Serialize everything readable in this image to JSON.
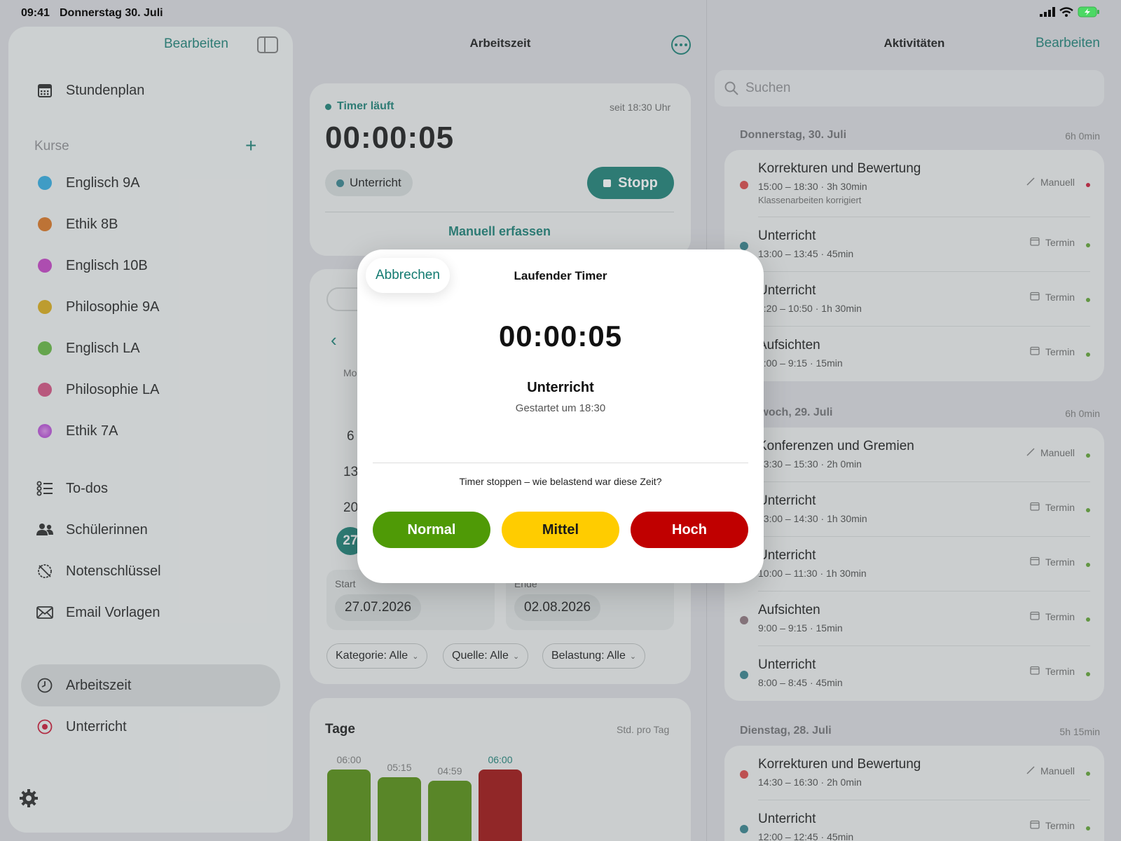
{
  "status": {
    "time": "09:41",
    "date": "Donnerstag 30. Juli"
  },
  "sidebar": {
    "edit_label": "Bearbeiten",
    "stundenplan": "Stundenplan",
    "courses_label": "Kurse",
    "add_symbol": "+",
    "courses": [
      {
        "label": "Englisch 9A",
        "color": "#2aa8e0"
      },
      {
        "label": "Ethik 8B",
        "color": "#d86f1a"
      },
      {
        "label": "Englisch 10B",
        "color": "#c23bc2"
      },
      {
        "label": "Philosophie 9A",
        "color": "#d9a810"
      },
      {
        "label": "Englisch LA",
        "color": "#5fb43a"
      },
      {
        "label": "Philosophie LA",
        "color": "#d24a7c"
      },
      {
        "label": "Ethik 7A",
        "color": "#b84bd6"
      }
    ],
    "nav": [
      {
        "label": "To-dos",
        "icon": "checklist-icon"
      },
      {
        "label": "Schülerinnen",
        "icon": "people-icon"
      },
      {
        "label": "Notenschlüssel",
        "icon": "grade-key-icon"
      },
      {
        "label": "Email Vorlagen",
        "icon": "envelope-icon"
      },
      {
        "label": "Arbeitszeit",
        "icon": "clock-icon",
        "active": true
      },
      {
        "label": "Unterricht",
        "icon": "target-icon"
      }
    ]
  },
  "main": {
    "title": "Arbeitszeit",
    "timer_status": "Timer läuft",
    "timer_since": "seit 18:30 Uhr",
    "timer_value": "00:00:05",
    "category": "Unterricht",
    "stop_label": "Stopp",
    "manual_label": "Manuell erfassen",
    "calendar": {
      "weekday": "Mo",
      "days": [
        "6",
        "13",
        "20",
        "27"
      ]
    },
    "start_label": "Start",
    "start_value": "27.07.2026",
    "end_label": "Ende",
    "end_value": "02.08.2026",
    "filters": [
      "Kategorie: Alle",
      "Quelle: Alle",
      "Belastung: Alle"
    ],
    "days_title": "Tage",
    "days_subtitle": "Std. pro Tag",
    "chart_data": {
      "type": "bar",
      "title": "Tage",
      "ylabel": "Std. pro Tag",
      "data_labels": [
        "06:00",
        "05:15",
        "04:59",
        "06:00"
      ],
      "values": [
        6.0,
        5.25,
        4.98,
        6.0
      ],
      "colors": [
        "#4e8a06",
        "#4e8a06",
        "#4e8a06",
        "#9b0606"
      ],
      "ylim": [
        0,
        6
      ]
    }
  },
  "activities": {
    "title": "Aktivitäten",
    "edit_label": "Bearbeiten",
    "search_placeholder": "Suchen",
    "days": [
      {
        "header": "Donnerstag, 30. Juli",
        "total": "6h 0min",
        "items": [
          {
            "title": "Korrekturen und Bewertung",
            "time": "15:00 – 18:30 · 3h 30min",
            "note": "Klassenarbeiten korrigiert",
            "source": "Manuell",
            "dot": "#d84040",
            "status": "#c8102e"
          },
          {
            "title": "Unterricht",
            "time": "13:00 – 13:45 · 45min",
            "source": "Termin",
            "dot": "#2f7d88",
            "status": "#5aa02c"
          },
          {
            "title": "Unterricht",
            "time": "9:20 – 10:50 · 1h 30min",
            "source": "Termin",
            "dot": "#2f7d88",
            "status": "#5aa02c"
          },
          {
            "title": "Aufsichten",
            "time": "9:00 – 9:15 · 15min",
            "source": "Termin",
            "dot": "#8a6f78",
            "status": "#5aa02c"
          }
        ]
      },
      {
        "header": "Mittwoch, 29. Juli",
        "total": "6h 0min",
        "items": [
          {
            "title": "Konferenzen und Gremien",
            "time": "13:30 – 15:30 · 2h 0min",
            "source": "Manuell",
            "dot": "#7c6fd0",
            "status": "#5aa02c"
          },
          {
            "title": "Unterricht",
            "time": "13:00 – 14:30 · 1h 30min",
            "source": "Termin",
            "dot": "#2f7d88",
            "status": "#5aa02c"
          },
          {
            "title": "Unterricht",
            "time": "10:00 – 11:30 · 1h 30min",
            "source": "Termin",
            "dot": "#2f7d88",
            "status": "#5aa02c"
          },
          {
            "title": "Aufsichten",
            "time": "9:00 – 9:15 · 15min",
            "source": "Termin",
            "dot": "#8a6f78",
            "status": "#5aa02c"
          },
          {
            "title": "Unterricht",
            "time": "8:00 – 8:45 · 45min",
            "source": "Termin",
            "dot": "#2f7d88",
            "status": "#5aa02c"
          }
        ]
      },
      {
        "header": "Dienstag, 28. Juli",
        "total": "5h 15min",
        "items": [
          {
            "title": "Korrekturen und Bewertung",
            "time": "14:30 – 16:30 · 2h 0min",
            "source": "Manuell",
            "dot": "#d84040",
            "status": "#5aa02c"
          },
          {
            "title": "Unterricht",
            "time": "12:00 – 12:45 · 45min",
            "source": "Termin",
            "dot": "#2f7d88",
            "status": "#5aa02c"
          }
        ]
      }
    ]
  },
  "modal": {
    "cancel_label": "Abbrechen",
    "title": "Laufender Timer",
    "timer_value": "00:00:05",
    "category": "Unterricht",
    "started": "Gestartet um 18:30",
    "question": "Timer stoppen – wie belastend war diese Zeit?",
    "buttons": [
      {
        "label": "Normal",
        "bg": "#4f9a06",
        "fg": "#ffffff"
      },
      {
        "label": "Mittel",
        "bg": "#ffcc00",
        "fg": "#1a1a1a"
      },
      {
        "label": "Hoch",
        "bg": "#c00000",
        "fg": "#ffffff"
      }
    ]
  },
  "colors": {
    "accent": "#127a70"
  }
}
